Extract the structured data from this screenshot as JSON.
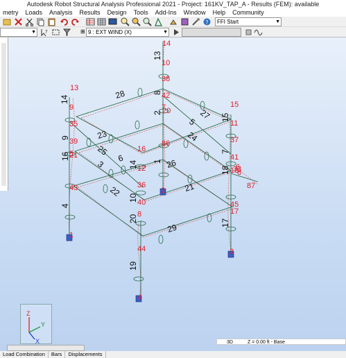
{
  "window": {
    "title": "Autodesk Robot Structural Analysis Professional 2021 - Project: 161KV_TAP_A - Results (FEM): available"
  },
  "menu": [
    "metry",
    "Loads",
    "Analysis",
    "Results",
    "Design",
    "Tools",
    "Add-Ins",
    "Window",
    "Help",
    "Community"
  ],
  "toolbar": {
    "load_case": "9 : EXT WIND (X)",
    "layout": "FFI Start"
  },
  "view": {
    "mode": "3D",
    "z_level": "Z = 0.00 ft - Base"
  },
  "axes": {
    "z": "Z",
    "y": "Y",
    "x": "X"
  },
  "status_tabs": [
    "Load Combination",
    "Bars",
    "Displacements"
  ],
  "colors": {
    "node_label": "#e0202c",
    "bar_label": "#111111",
    "support": "#3a5fc8",
    "bar": "#2a6a4a",
    "deformed": "#d06060"
  },
  "nodes": [
    "1",
    "2",
    "3",
    "4",
    "5",
    "6",
    "7",
    "8",
    "9",
    "10",
    "11",
    "12",
    "13",
    "14",
    "15",
    "16",
    "17",
    "18",
    "20",
    "21",
    "22",
    "23",
    "24",
    "26",
    "27",
    "28",
    "33",
    "34",
    "35",
    "36",
    "37",
    "38",
    "39",
    "40",
    "41",
    "42",
    "43",
    "44",
    "45",
    "86",
    "87"
  ],
  "bars": [
    "1",
    "2",
    "3",
    "4",
    "5",
    "6",
    "7",
    "8",
    "9",
    "10",
    "12",
    "13",
    "14",
    "15",
    "16",
    "17",
    "18",
    "19",
    "20",
    "21",
    "22",
    "23",
    "24",
    "25",
    "26",
    "27",
    "28",
    "29"
  ]
}
